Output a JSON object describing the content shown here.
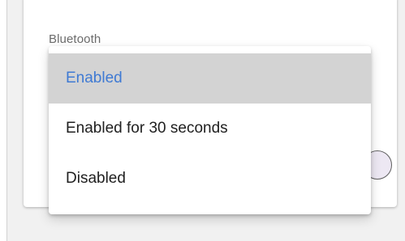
{
  "field": {
    "label": "Bluetooth"
  },
  "dropdown": {
    "selected_value": "Enabled",
    "options": [
      {
        "label": "Enabled",
        "selected": true
      },
      {
        "label": "Enabled for 30 seconds",
        "selected": false
      },
      {
        "label": "Disabled",
        "selected": false
      }
    ]
  },
  "colors": {
    "accent": "#3f7ad3",
    "selected_background": "#d3d3d3",
    "text": "#202020"
  }
}
